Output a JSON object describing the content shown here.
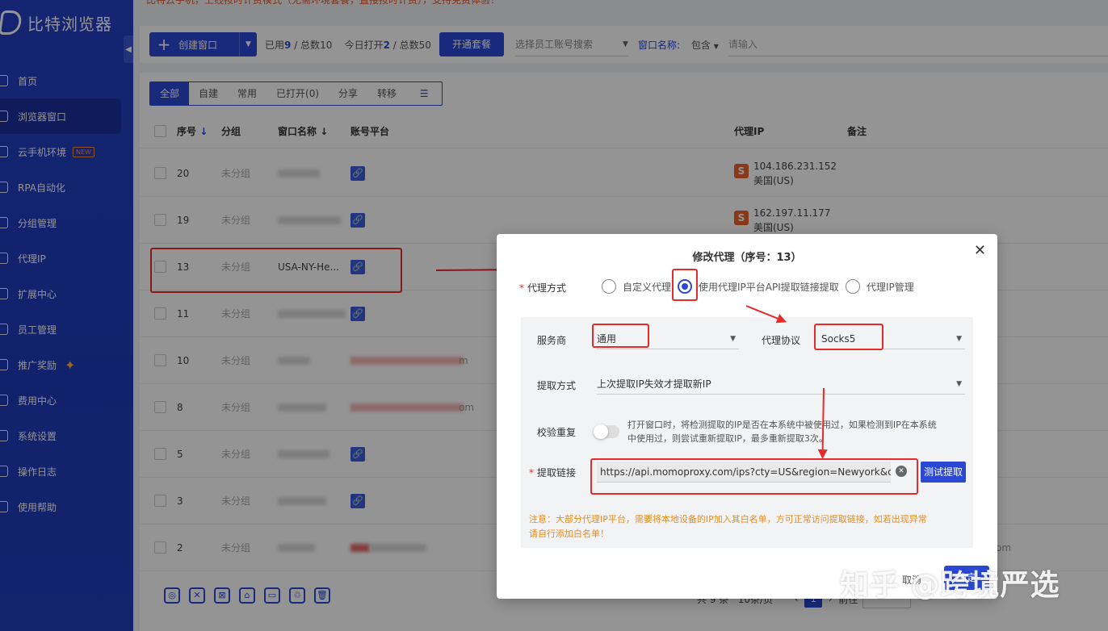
{
  "app": {
    "name": "比特浏览器"
  },
  "notice": "比特云手机，上线按时计费模式（无需环境套餐，直接按时计费），支持免费体验！",
  "sidebar": {
    "items": [
      {
        "label": "首页",
        "icon": "home-icon"
      },
      {
        "label": "浏览器窗口",
        "icon": "browser-window-icon",
        "active": true
      },
      {
        "label": "云手机环境",
        "icon": "cloud-phone-icon",
        "badge": "NEW"
      },
      {
        "label": "RPA自动化",
        "icon": "rpa-icon"
      },
      {
        "label": "分组管理",
        "icon": "group-icon"
      },
      {
        "label": "代理IP",
        "icon": "location-icon"
      },
      {
        "label": "扩展中心",
        "icon": "extension-icon"
      },
      {
        "label": "员工管理",
        "icon": "user-icon"
      },
      {
        "label": "推广奖励",
        "icon": "gift-icon",
        "sparkle": "✦"
      },
      {
        "label": "费用中心",
        "icon": "shield-icon"
      },
      {
        "label": "系统设置",
        "icon": "gear-icon"
      },
      {
        "label": "操作日志",
        "icon": "log-icon"
      },
      {
        "label": "使用帮助",
        "icon": "help-icon"
      }
    ]
  },
  "toolbar": {
    "create_label": "创建窗口",
    "used_prefix": "已用",
    "used": "9",
    "total_prefix": " / 总数",
    "total": "10",
    "today_prefix": "今日打开",
    "today": "2",
    "today_total_prefix": " / 总数",
    "today_total": "50",
    "plan_label": "开通套餐",
    "employee_placeholder": "选择员工账号搜索",
    "window_name_label": "窗口名称:",
    "match_mode": "包含",
    "search_placeholder": "请输入"
  },
  "tabs": [
    "全部",
    "自建",
    "常用",
    "已打开(0)",
    "分享",
    "转移"
  ],
  "table": {
    "headers": {
      "index": "序号",
      "group": "分组",
      "name": "窗口名称",
      "platform": "账号平台",
      "proxy": "代理IP",
      "remark": "备注"
    },
    "rows": [
      {
        "index": "20",
        "group": "未分组",
        "name": "",
        "proxy_ip": "104.186.231.152",
        "proxy_region": "美国(US)"
      },
      {
        "index": "19",
        "group": "未分组",
        "name": "",
        "proxy_ip": "162.197.11.177",
        "proxy_region": "美国(US)"
      },
      {
        "index": "13",
        "group": "未分组",
        "name": "USA-NY-He...",
        "proxy_ip": "",
        "proxy_region": ""
      },
      {
        "index": "11",
        "group": "未分组",
        "name": "",
        "proxy_ip": "",
        "proxy_region": ""
      },
      {
        "index": "10",
        "group": "未分组",
        "name": "",
        "platform_suffix": "m",
        "proxy_ip": "",
        "proxy_region": ""
      },
      {
        "index": "8",
        "group": "未分组",
        "name": "",
        "platform_suffix": "om",
        "proxy_ip": "",
        "proxy_region": ""
      },
      {
        "index": "5",
        "group": "未分组",
        "name": "",
        "proxy_ip": "",
        "proxy_region": ""
      },
      {
        "index": "3",
        "group": "未分组",
        "name": "",
        "proxy_ip": "",
        "proxy_region": ""
      },
      {
        "index": "2",
        "group": "未分组",
        "name": "",
        "remark_tail": "om",
        "proxy_ip": "",
        "proxy_region": ""
      }
    ]
  },
  "pager": {
    "total": "共 9 条",
    "per_page": "10条/页",
    "prev": "前往"
  },
  "modal": {
    "title": "修改代理（序号：13）",
    "proxy_mode_label": "代理方式",
    "options": [
      "自定义代理",
      "使用代理IP平台API提取链接提取",
      "代理IP管理"
    ],
    "selected_option": 1,
    "provider_label": "服务商",
    "provider_value": "通用",
    "protocol_label": "代理协议",
    "protocol_value": "Socks5",
    "extract_mode_label": "提取方式",
    "extract_mode_value": "上次提取IP失效才提取新IP",
    "verify_label": "校验重复",
    "verify_desc_1": "打开窗口时，将检测提取的IP是否在本系统中被使用过，如果检测到IP在本系统",
    "verify_desc_2": "中使用过，则尝试重新提取IP，最多重新提取3次。",
    "link_label": "提取链接",
    "link_value": "https://api.momoproxy.com/ips?cty=US&region=Newyork&ci",
    "test_label": "测试提取",
    "note_1": "注意：大部分代理IP平台，需要将本地设备的IP加入其白名单，方可正常访问提取链接，如若出现异常",
    "note_2": "请自行添加白名单！",
    "cancel_label": "取消",
    "ok_label": "确定"
  },
  "watermark": "知乎 @跨境严选",
  "colors": {
    "primary": "#2b48d4",
    "annotation": "#e62b2b",
    "warning": "#e88b1a",
    "proxy_s": "#e8632a"
  }
}
